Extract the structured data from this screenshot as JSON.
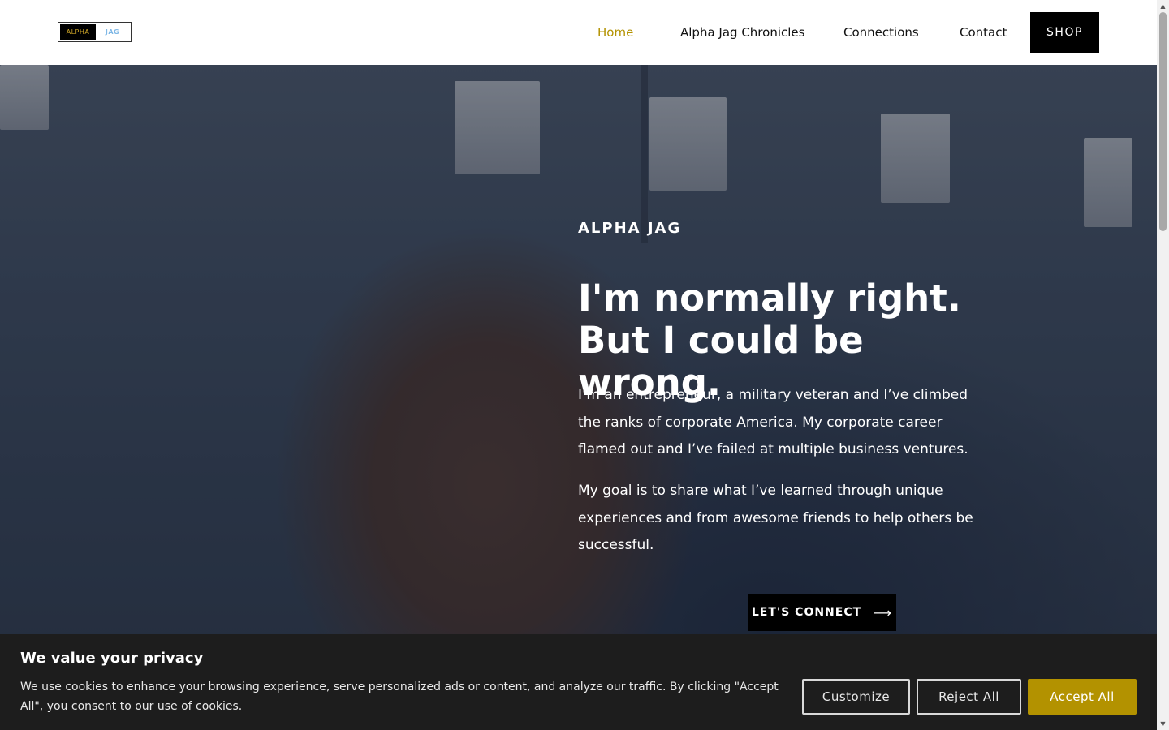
{
  "header": {
    "logo": {
      "left_text": "ALPHA",
      "right_text": "JAG",
      "left_color": "#c9a227",
      "right_color": "#7fb8e6"
    },
    "nav": [
      {
        "label": "Home",
        "active": true
      },
      {
        "label": "Alpha Jag Chronicles",
        "active": false
      },
      {
        "label": "Connections",
        "active": false
      },
      {
        "label": "Contact",
        "active": false
      }
    ],
    "shop_label": "SHOP",
    "active_color": "#b39200"
  },
  "hero": {
    "kicker": "ALPHA JAG",
    "headline": "I'm normally right. But I could be wrong.",
    "paragraph1": "I’m an entrepreneur, a military veteran and I’ve climbed the ranks of corporate America.  My corporate career flamed out and I’ve failed at multiple business ventures.",
    "paragraph2": "My goal is to share what I’ve learned through unique experiences and from awesome friends to help others be successful.",
    "cta_label": "LET'S CONNECT",
    "cta_icon": "arrow-right-icon"
  },
  "cookie_banner": {
    "title": "We value your privacy",
    "text": "We use cookies to enhance your browsing experience, serve personalized ads or content, and analyze our traffic. By clicking \"Accept All\", you consent to our use of cookies.",
    "customize_label": "Customize",
    "reject_label": "Reject All",
    "accept_label": "Accept All",
    "accent_color": "#b39200"
  }
}
